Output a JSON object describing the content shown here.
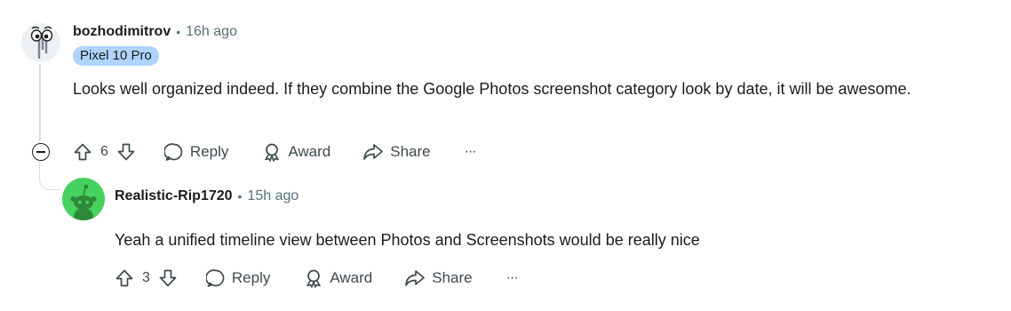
{
  "comments": [
    {
      "author": "bozhodimitrov",
      "time": "16h ago",
      "flair": "Pixel 10 Pro",
      "body": "Looks well organized indeed. If they combine the Google Photos screenshot category look by date, it will be awesome.",
      "votes": "6",
      "reply_label": "Reply",
      "award_label": "Award",
      "share_label": "Share",
      "more_label": "···"
    },
    {
      "author": "Realistic-Rip1720",
      "time": "15h ago",
      "body": "Yeah a unified timeline view between Photos and Screenshots would be really nice",
      "votes": "3",
      "reply_label": "Reply",
      "award_label": "Award",
      "share_label": "Share",
      "more_label": "···"
    }
  ],
  "separator": "•",
  "colors": {
    "flair_bg": "#aed4ff",
    "thread_line": "#d8dde0",
    "muted": "#576f76",
    "reply_avatar_bg": "#46d160"
  },
  "icons": [
    "paperclip-avatar-icon",
    "snoo-avatar-icon",
    "upvote-icon",
    "downvote-icon",
    "comment-icon",
    "award-icon",
    "share-icon",
    "more-icon",
    "collapse-icon"
  ]
}
